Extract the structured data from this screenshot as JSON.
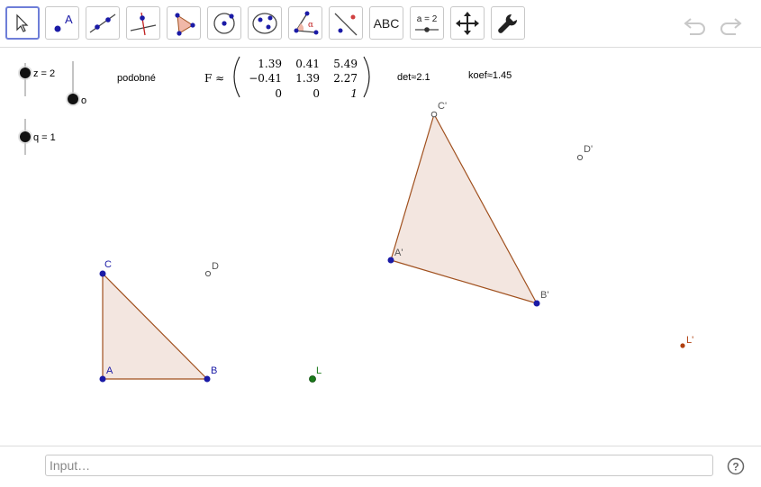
{
  "toolbar": {
    "tools": [
      {
        "name": "move-tool",
        "icon": "arrow-cursor-icon"
      },
      {
        "name": "point-tool",
        "icon": "point-icon",
        "label": "A"
      },
      {
        "name": "line-tool",
        "icon": "line-through-two-points-icon"
      },
      {
        "name": "perpendicular-line-tool",
        "icon": "perpendicular-line-icon"
      },
      {
        "name": "polygon-tool",
        "icon": "polygon-icon"
      },
      {
        "name": "circle-tool",
        "icon": "circle-with-center-icon"
      },
      {
        "name": "conic-tool",
        "icon": "ellipse-icon"
      },
      {
        "name": "angle-tool",
        "icon": "angle-icon",
        "label": "α"
      },
      {
        "name": "reflect-tool",
        "icon": "reflect-about-line-icon"
      },
      {
        "name": "text-tool",
        "label": "ABC"
      },
      {
        "name": "slider-tool",
        "label": "a = 2"
      },
      {
        "name": "move-graphics-view-tool",
        "icon": "move-arrows-icon"
      },
      {
        "name": "settings-tool",
        "icon": "wrench-icon"
      }
    ],
    "undo_icon": "undo-icon",
    "redo_icon": "redo-icon"
  },
  "canvas": {
    "sliders": [
      {
        "label": "z = 2",
        "orientation": "vertical"
      },
      {
        "label": "o",
        "orientation": "vertical"
      },
      {
        "label": "q = 1",
        "orientation": "vertical"
      }
    ],
    "text_similar": "podobné",
    "matrix": {
      "name": "F ≈",
      "rows": [
        [
          "1.39",
          "0.41",
          "5.49"
        ],
        [
          "−0.41",
          "1.39",
          "2.27"
        ],
        [
          "0",
          "0",
          "1"
        ]
      ]
    },
    "det": "det≈2.1",
    "koef": "koef≈1.45",
    "points": {
      "A": "A",
      "B": "B",
      "C": "C",
      "D": "D",
      "L": "L",
      "A_img": "A'",
      "B_img": "B'",
      "C_img": "C'",
      "D_img": "D'",
      "L_img": "L'"
    },
    "colors": {
      "point_blue": "#1a1aa6",
      "point_green": "#1a7a1a",
      "point_red": "#b04010",
      "polygon_fill": "#f3e6e0",
      "polygon_stroke": "#a0501e"
    }
  },
  "input_bar": {
    "placeholder": "Input…",
    "help_icon": "help-icon"
  }
}
